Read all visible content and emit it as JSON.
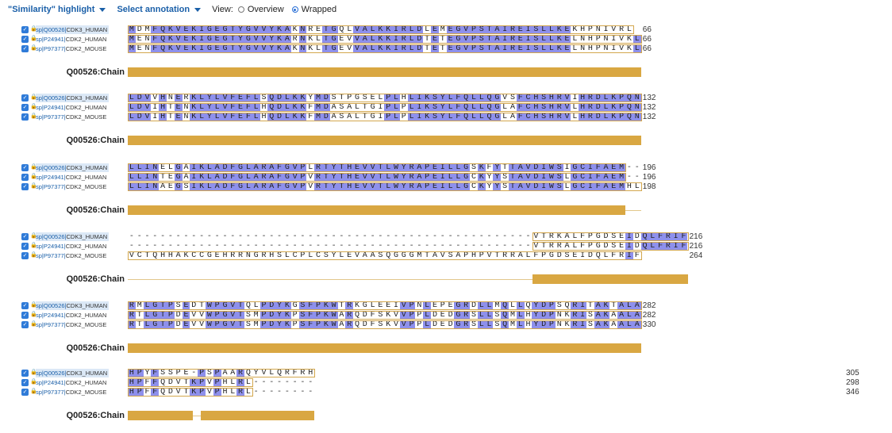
{
  "toolbar": {
    "highlight_label": "\"Similarity\" highlight",
    "annotation_label": "Select annotation",
    "view_label": "View:",
    "options": [
      "Overview",
      "Wrapped"
    ],
    "selected": "Wrapped"
  },
  "sequences": [
    {
      "accession": "sp|Q00526|",
      "name": "CDK3_HUMAN",
      "highlighted": true
    },
    {
      "accession": "sp|P24941|",
      "name": "CDK2_HUMAN",
      "highlighted": false
    },
    {
      "accession": "sp|P97377|",
      "name": "CDK2_MOUSE",
      "highlighted": false
    }
  ],
  "chain_label": "Q00526:Chain",
  "colors": {
    "similar": "#8e90ec",
    "box": "#d3a74d",
    "chain": "#d9a742",
    "link": "#1a5fa8"
  },
  "blocks": [
    {
      "rows": [
        {
          "seq": "MDMFQKVEKIGEGTYGVVYKAKNRETGQLVALKKIRLDLEMEGVPSTAIREISLLKEKHPNIVRL",
          "end": "66"
        },
        {
          "seq": "MENFQKVEKIGEGTYGVVYKARNKLTGEVVALKKIRLDTETEGVPSTAIREISLLKELNHPNIVKL",
          "end": "66"
        },
        {
          "seq": "MENFQKVEKIGEGTYGVVYKAKNKLTGEVVALKKIRLDTETEGVPSTAIREISLLKELNHPNIVKL",
          "end": "66"
        }
      ]
    },
    {
      "rows": [
        {
          "seq": "LDVVHNERKLYLVFEFLSQDLKKYMDSTPGSELPLHLIKSYLFQLLQGVSFCHSHRVIHRDLKPQN",
          "end": "132"
        },
        {
          "seq": "LDVIHTENKLYLVFEFLHQDLKKFMDASALTGIPLPLIKSYLFQLLQGLAFCHSHRVLHRDLKPQN",
          "end": "132"
        },
        {
          "seq": "LDVIHTENKLYLVFEFLHQDLKKFMDASALTGIPLPLIKSYLFQLLQGLAFCHSHRVLHRDLKPQN",
          "end": "132"
        }
      ]
    },
    {
      "rows": [
        {
          "seq": "LLINELGAIKLADFGLARAFGVPLRTYTHEVVTLWYRAPEILLGSKFYTTAVDIWSIGCIFAEM--",
          "end": "196"
        },
        {
          "seq": "LLINTEGAIKLADFGLARAFGVPVRTYTHEVVTLWYRAPEILLGCKYYSTAVDIWSLGCIFAEM--",
          "end": "196"
        },
        {
          "seq": "LLINAEGSIKLADFGLARAFGVPVRTYTHEVVTLWYRAPEILLGCKYYSTAVDIWSLGCIFAEMHL",
          "end": "198"
        }
      ]
    },
    {
      "rows": [
        {
          "seq": "----------------------------------------------------VTRKALFPGDSEIDQLFRIF",
          "end": "216"
        },
        {
          "seq": "----------------------------------------------------VTRRALFPGDSEIDQLFRIF",
          "end": "216"
        },
        {
          "seq": "VCTQHHAKCCGEHRRNGRHSLCPLCSYLEVAASQGGGMTAVSAPHPVTRRALFPGDSEIDQLFRIF",
          "end": "264"
        }
      ]
    },
    {
      "rows": [
        {
          "seq": "RMLGTPSEDTWPGVTQLPDYKGSFPKWTRKGLEEIVPNLEPEGRDLLMQLLQYDPSQRITAKTALA",
          "end": "282"
        },
        {
          "seq": "RTLGTPDEVVWPGVTSMPDYKPSFPKWARQDFSKVVPPLDEDGRSLLSQMLHYDPNKRISAKAALA",
          "end": "282"
        },
        {
          "seq": "RTLGTPDEVVWPGVTSMPDYKPSFPKWARQDFSKVVPPLDEDGRSLLSQMLHYDPNKRISAKAALA",
          "end": "330"
        }
      ]
    },
    {
      "rows": [
        {
          "seq": "HPYFSSPE-PSPAARQYVLQRFRH",
          "end": "305"
        },
        {
          "seq": "HPFFQDVTKPVPHLRL--------",
          "end": "298"
        },
        {
          "seq": "HPFFQDVTKPVPHLRL--------",
          "end": "346"
        }
      ]
    }
  ]
}
